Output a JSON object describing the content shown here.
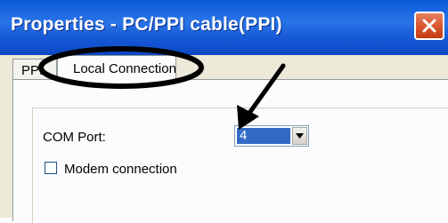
{
  "window": {
    "title": "Properties - PC/PPI cable(PPI)"
  },
  "tabs": [
    {
      "label": "PPI",
      "selected": false
    },
    {
      "label": "Local Connection",
      "selected": true
    }
  ],
  "local_connection": {
    "com_port_label": "COM Port:",
    "com_port_value": "4",
    "modem_label": "Modem connection",
    "modem_checked": false
  },
  "annotations": {
    "highlight_ellipse_target": "Local Connection tab",
    "arrow_target": "COM Port selector"
  },
  "colors": {
    "titlebar": "#0b47c4",
    "close_button": "#d9532c",
    "selection": "#316ac5",
    "annotation": "#000000"
  }
}
